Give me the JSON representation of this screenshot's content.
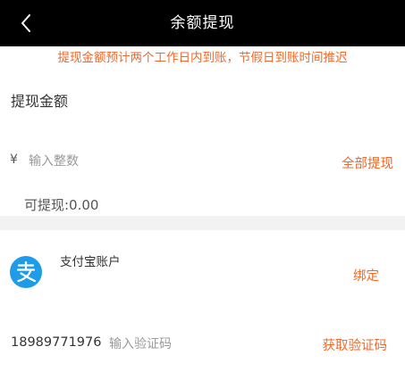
{
  "header": {
    "title": "余额提现",
    "back_icon": "chevron-left-icon"
  },
  "notice": "提现金额预计两个工作日内到账，节假日到账时间推迟",
  "amount": {
    "label": "提现金额",
    "currency_symbol": "¥",
    "placeholder": "输入整数",
    "value": "",
    "withdraw_all_label": "全部提现",
    "available_text": "可提现:0.00"
  },
  "alipay": {
    "icon": "alipay-icon",
    "label": "支付宝账户",
    "bind_label": "绑定"
  },
  "verification": {
    "phone": "18989771976",
    "placeholder": "输入验证码",
    "value": "",
    "get_code_label": "获取验证码"
  },
  "colors": {
    "accent": "#ee6a2c",
    "header_bg": "#000000",
    "alipay_blue": "#1e9be9",
    "divider": "#f2f2f2"
  }
}
